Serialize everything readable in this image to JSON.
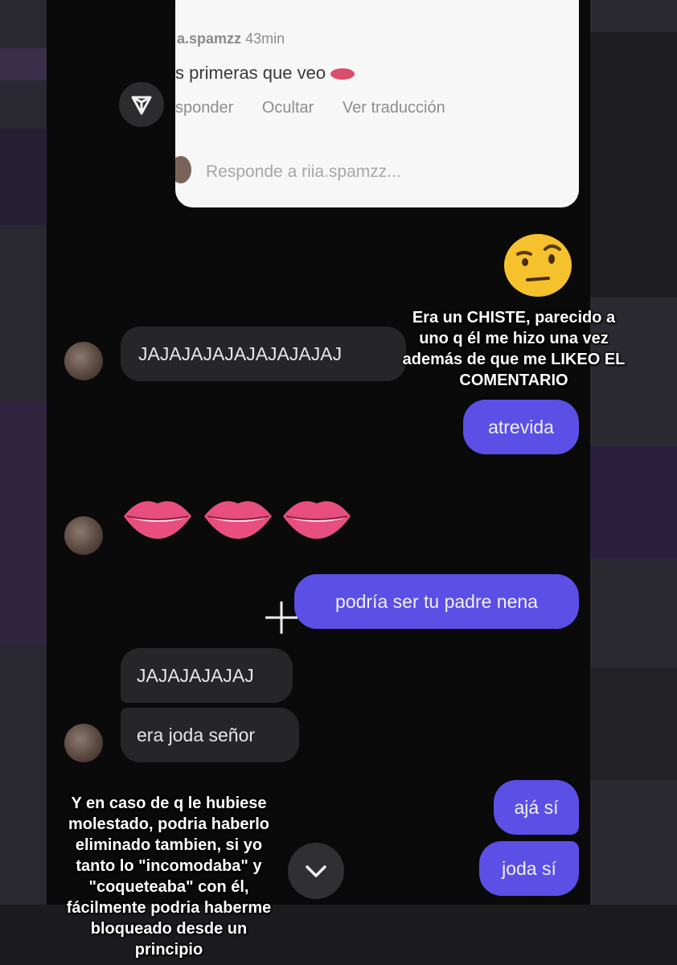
{
  "comment_card": {
    "username": "a.spamzz",
    "time": "43min",
    "text": "s primeras que veo",
    "actions": [
      "sponder",
      "Ocultar",
      "Ver traducción"
    ],
    "reply_placeholder": "Responde a riia.spamzz..."
  },
  "messages": {
    "in_1": "JAJAJAJAJAJAJAJAJAJ",
    "out_1": "atrevida",
    "out_2": "podría ser tu padre nena",
    "in_2": "JAJAJAJAJAJ",
    "in_3": "era joda señor",
    "out_3": "ajá sí",
    "out_4": "joda sí"
  },
  "captions": {
    "top": [
      "Era un CHISTE, parecido a",
      "uno q él me hizo una vez",
      "además de que me LIKEO EL",
      "COMENTARIO"
    ],
    "bottom": [
      "Y en caso de q le hubiese",
      "molestado, podria haberlo",
      "eliminado tambien, si yo",
      "tanto lo \"incomodaba\" y",
      "\"coqueteaba\" con él,",
      "fácilmente podria haberme",
      "bloqueado desde un",
      "principio"
    ]
  },
  "icons": {
    "send": "send-icon",
    "face": "raised-eyebrow-emoji",
    "lips": "lips-emoji",
    "plus": "plus-icon",
    "scroll": "chevron-down-icon"
  },
  "colors": {
    "outgoing_bubble": "#5b4fe6",
    "incoming_bubble": "#262628",
    "background": "#0a0a0b"
  }
}
